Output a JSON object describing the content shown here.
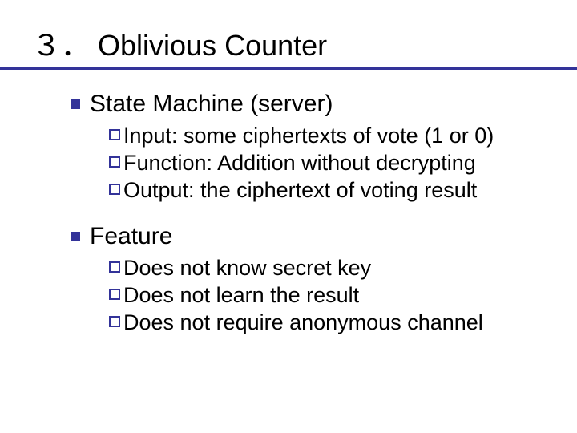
{
  "title": {
    "number": "３．",
    "text": "Oblivious Counter"
  },
  "sections": [
    {
      "heading": "State Machine (server)",
      "items": [
        "Input: some ciphertexts of vote (1 or 0)",
        "Function: Addition without decrypting",
        "Output: the ciphertext of voting result"
      ]
    },
    {
      "heading": "Feature",
      "items": [
        "Does not know secret key",
        "Does not learn the result",
        "Does not require anonymous channel"
      ]
    }
  ]
}
